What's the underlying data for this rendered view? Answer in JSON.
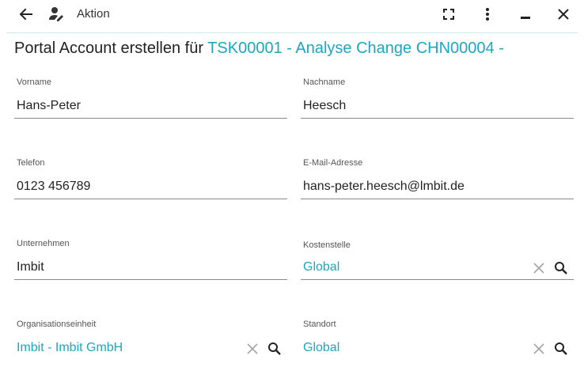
{
  "toolbar": {
    "title": "Aktion",
    "icons": [
      "arrow-left-icon",
      "user-edit-icon",
      "fullscreen-icon",
      "more-vert-icon",
      "minimize-icon",
      "close-icon"
    ]
  },
  "heading": {
    "prefix": "Portal Account erstellen für ",
    "reference": "TSK00001 - Analyse Change CHN00004 -"
  },
  "colors": {
    "accent": "#1aa8c0",
    "text": "#222222"
  },
  "fields": {
    "vorname": {
      "label": "Vorname",
      "value": "Hans-Peter"
    },
    "nachname": {
      "label": "Nachname",
      "value": "Heesch"
    },
    "telefon": {
      "label": "Telefon",
      "value": "0123 456789"
    },
    "email": {
      "label": "E-Mail-Adresse",
      "value": "hans-peter.heesch@lmbit.de"
    },
    "unternehmen": {
      "label": "Unternehmen",
      "value": "Imbit"
    },
    "kostenstelle": {
      "label": "Kostenstelle",
      "value": "Global"
    },
    "organisationseinheit": {
      "label": "Organisationseinheit",
      "value": "Imbit - Imbit GmbH"
    },
    "standort": {
      "label": "Standort",
      "value": "Global"
    }
  }
}
